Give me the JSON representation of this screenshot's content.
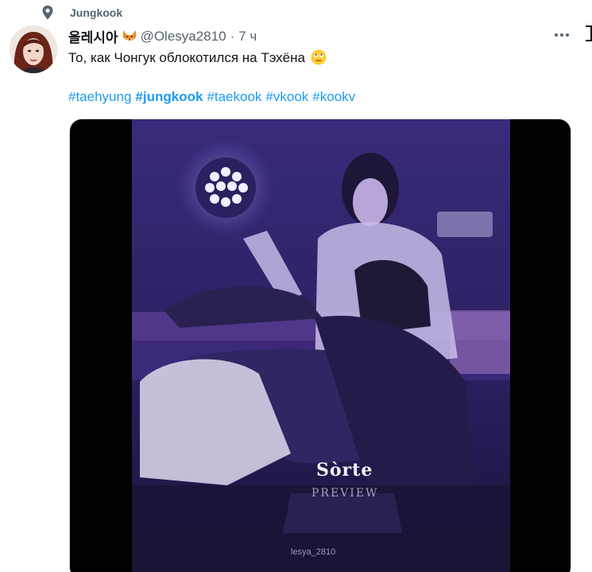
{
  "social_context": {
    "label": "Jungkook",
    "icon": "pin-icon"
  },
  "author": {
    "display_name": "올레시아",
    "badge_icon": "fox-emoji-icon",
    "handle": "@Olesya2810",
    "separator": "·",
    "time": "7 ч"
  },
  "tweet": {
    "text": "То, как Чонгук облокотился на Тэхёна",
    "text_emoji_icon": "face-with-rolling-eyes-icon",
    "hashtags": [
      {
        "label": "#taehyung",
        "bold": false
      },
      {
        "label": "#jungkook",
        "bold": true
      },
      {
        "label": "#taekook",
        "bold": false
      },
      {
        "label": "#vkook",
        "bold": false
      },
      {
        "label": "#kookv",
        "bold": false
      }
    ]
  },
  "media": {
    "watermark_brand": "Sòrte",
    "watermark_sub": "PREVIEW",
    "watermark_user": "lesya_2810"
  },
  "colors": {
    "accent": "#1d9bf0",
    "secondary_text": "#536471",
    "primary_text": "#0f1419",
    "video_tint": "#3a2a78"
  }
}
